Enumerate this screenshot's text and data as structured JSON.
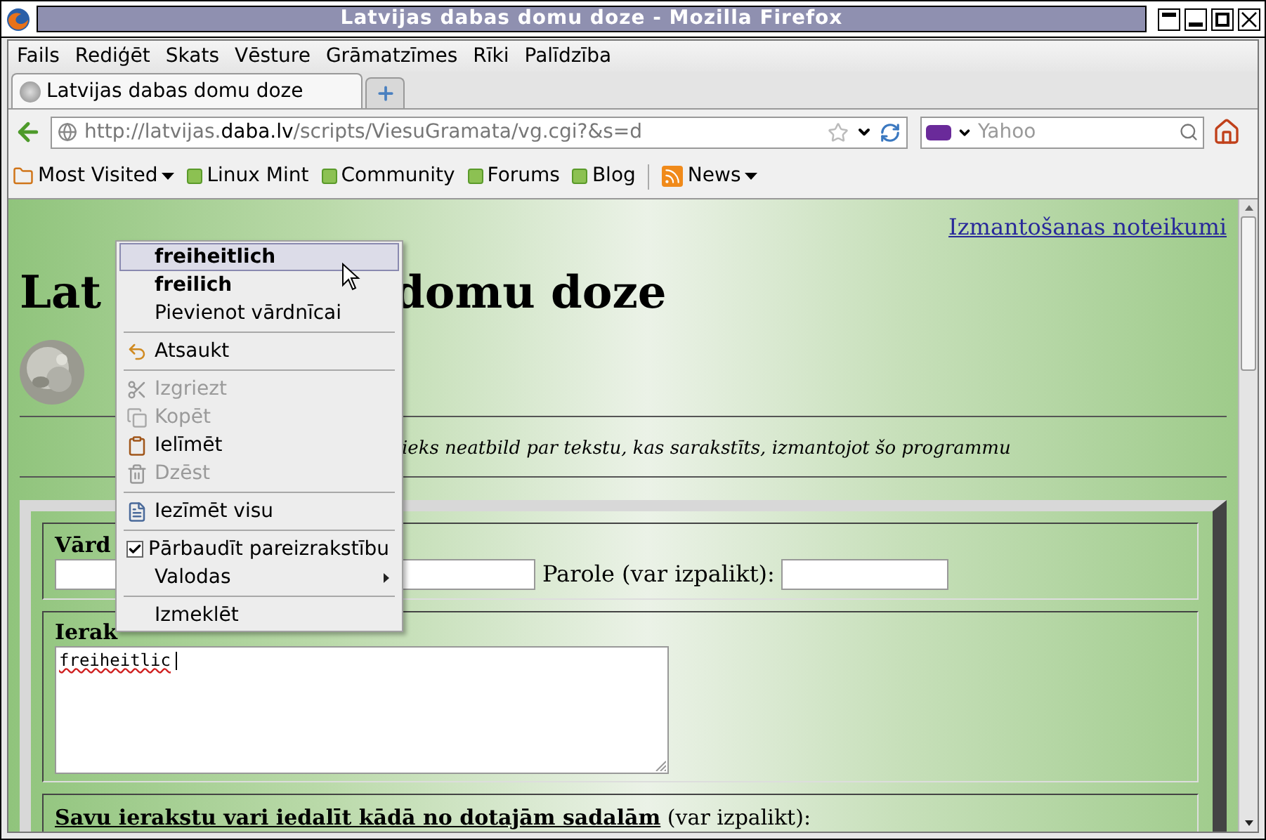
{
  "window": {
    "title": "Latvijas dabas domu doze - Mozilla Firefox"
  },
  "menu_bar": [
    "Fails",
    "Rediģēt",
    "Skats",
    "Vēsture",
    "Grāmatzīmes",
    "Rīki",
    "Palīdzība"
  ],
  "tabs": [
    {
      "label": "Latvijas dabas domu doze",
      "selected": true
    }
  ],
  "address_bar": {
    "url_prefix": "http://latvijas.",
    "url_domain": "daba.lv",
    "url_path": "/scripts/ViesuGramata/vg.cgi?&s=d"
  },
  "search": {
    "placeholder": "Yahoo"
  },
  "bookmarks": [
    {
      "label": "Most Visited",
      "kind": "folder"
    },
    {
      "label": "Linux Mint",
      "kind": "link"
    },
    {
      "label": "Community",
      "kind": "link"
    },
    {
      "label": "Forums",
      "kind": "link"
    },
    {
      "label": "Blog",
      "kind": "link"
    },
    {
      "label": "News",
      "kind": "feed"
    }
  ],
  "page": {
    "terms_link": "Izmantošanas noteikumi",
    "heading_left": "Lat",
    "heading_right": "domu doze",
    "disclaimer": "ieks neatbild par tekstu, kas sarakstīts, izmantojot šo programmu",
    "name_label": "Vārd",
    "password_label": "Parole (var izpalikt):",
    "entry_label": "Ierak",
    "entry_text": "freiheitlic",
    "category_label": "Savu ierakstu vari iedalīt kādā no dotajām sadalām",
    "category_note": "(var izpalikt):"
  },
  "context_menu": [
    {
      "kind": "suggestion",
      "label": "freiheitlich",
      "selected": true,
      "disabled": false
    },
    {
      "kind": "suggestion",
      "label": "freilich",
      "selected": false,
      "disabled": false
    },
    {
      "kind": "action",
      "label": "Pievienot vārdnīcai",
      "selected": false,
      "disabled": false
    },
    {
      "kind": "separator"
    },
    {
      "kind": "undo",
      "label": "Atsaukt",
      "selected": false,
      "disabled": false
    },
    {
      "kind": "separator"
    },
    {
      "kind": "cut",
      "label": "Izgriezt",
      "selected": false,
      "disabled": true
    },
    {
      "kind": "copy",
      "label": "Kopēt",
      "selected": false,
      "disabled": true
    },
    {
      "kind": "paste",
      "label": "Ielīmēt",
      "selected": false,
      "disabled": false
    },
    {
      "kind": "delete",
      "label": "Dzēst",
      "selected": false,
      "disabled": true
    },
    {
      "kind": "separator"
    },
    {
      "kind": "select_all",
      "label": "Iezīmēt visu",
      "selected": false,
      "disabled": false
    },
    {
      "kind": "separator"
    },
    {
      "kind": "check",
      "label": "Pārbaudīt pareizrakstību",
      "checked": true,
      "selected": false,
      "disabled": false
    },
    {
      "kind": "submenu",
      "label": "Valodas",
      "selected": false,
      "disabled": false
    },
    {
      "kind": "separator"
    },
    {
      "kind": "action",
      "label": "Izmeklēt",
      "selected": false,
      "disabled": false
    }
  ]
}
